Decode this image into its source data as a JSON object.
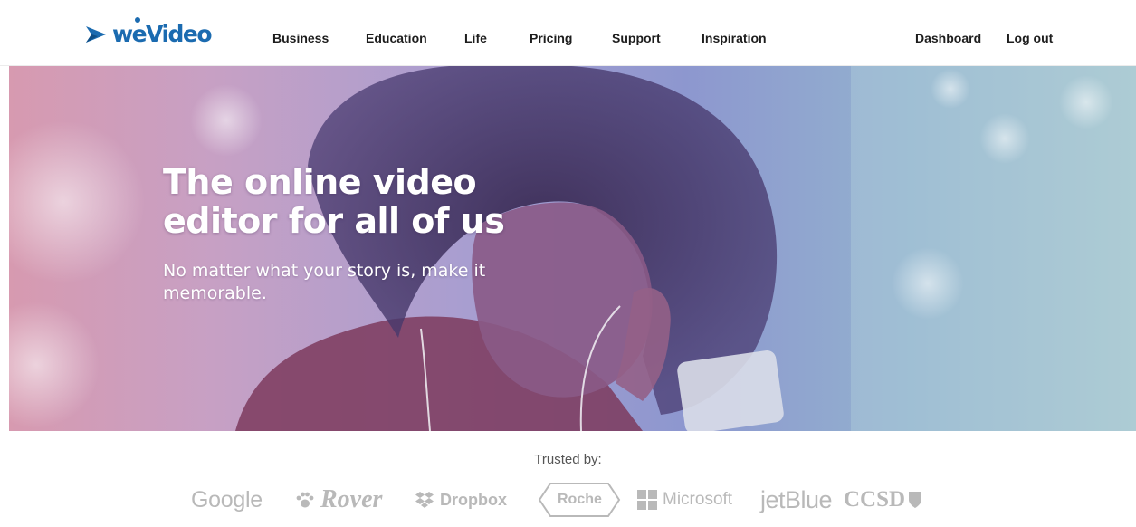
{
  "brand": {
    "name": "WeVideo",
    "logo_text": "weVideo",
    "logo_color": "#1b6bb0"
  },
  "nav": {
    "items": [
      {
        "label": "Business"
      },
      {
        "label": "Education"
      },
      {
        "label": "Life"
      },
      {
        "label": "Pricing"
      },
      {
        "label": "Support"
      },
      {
        "label": "Inspiration"
      }
    ],
    "right": [
      {
        "label": "Dashboard"
      },
      {
        "label": "Log out"
      }
    ]
  },
  "hero": {
    "title": "The online video editor for all of us",
    "subtitle": "No matter what your story is, make it memorable.",
    "overlay_colors": [
      "#d79ab0",
      "#a99ed0",
      "#8d97cf",
      "#a8c6cf"
    ]
  },
  "trusted": {
    "label": "Trusted by:",
    "logos": [
      {
        "name": "Google",
        "text": "Google"
      },
      {
        "name": "Rover",
        "text": "Rover"
      },
      {
        "name": "Dropbox",
        "text": "Dropbox",
        "icon": "dropbox-icon"
      },
      {
        "name": "Roche",
        "text": "Roche"
      },
      {
        "name": "Microsoft",
        "text": "Microsoft",
        "icon": "windows-grid-icon"
      },
      {
        "name": "jetBlue",
        "text": "jetBlue"
      },
      {
        "name": "CCSD",
        "text": "CCSD"
      }
    ],
    "logo_color": "#b9b9b9"
  }
}
